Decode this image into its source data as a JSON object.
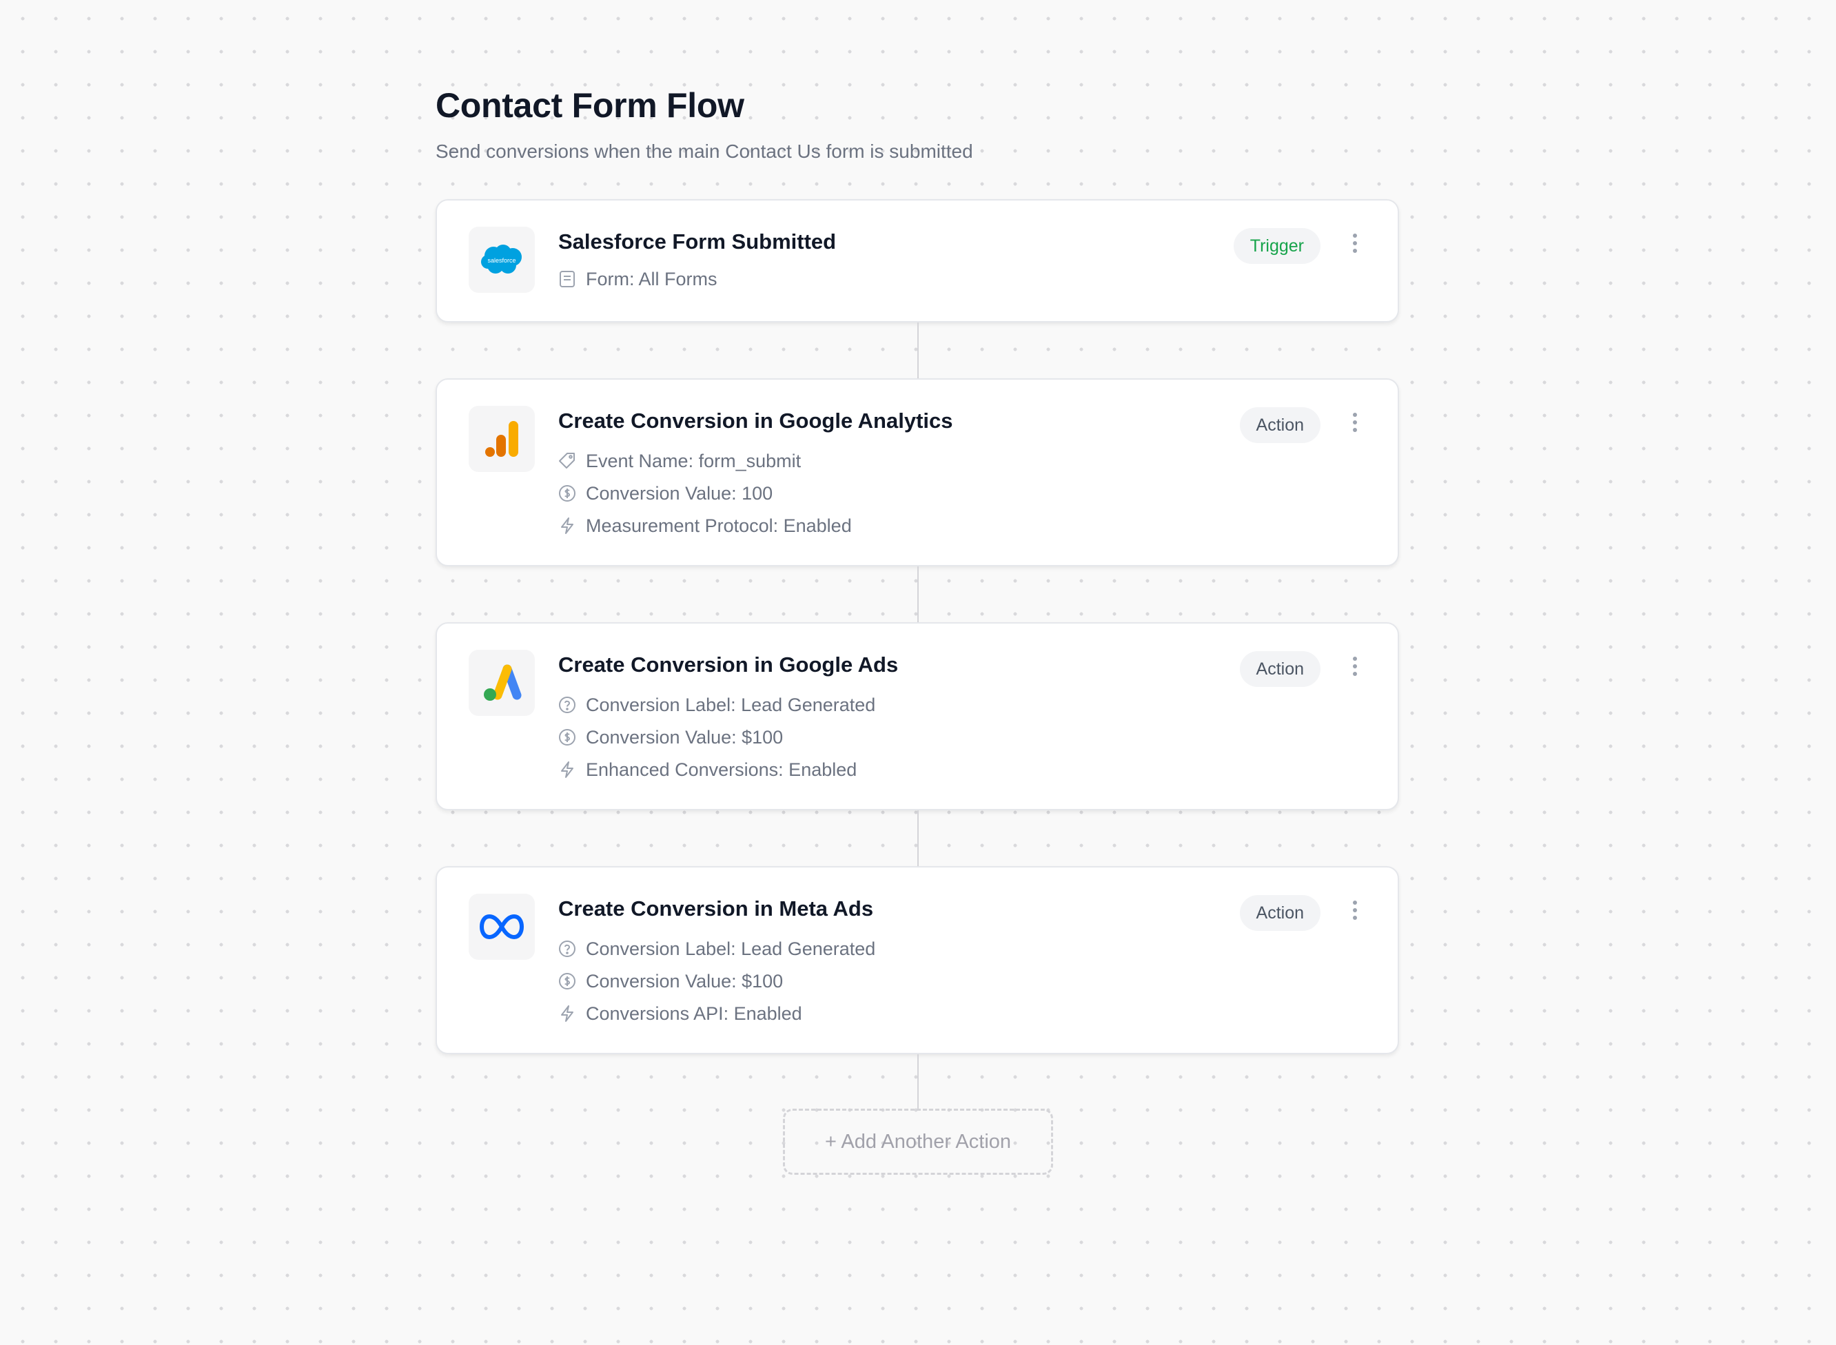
{
  "flow": {
    "title": "Contact Form Flow",
    "subtitle": "Send conversions when the main Contact Us form is submitted"
  },
  "steps": [
    {
      "title": "Salesforce Form Submitted",
      "badge": "Trigger",
      "logo": "salesforce-logo",
      "logo_text": "salesforce",
      "details": [
        {
          "icon": "form-icon",
          "text": "Form: All Forms"
        }
      ]
    },
    {
      "title": "Create Conversion in Google Analytics",
      "badge": "Action",
      "logo": "google-analytics-logo",
      "details": [
        {
          "icon": "tag-icon",
          "text": "Event Name: form_submit"
        },
        {
          "icon": "dollar-circle-icon",
          "text": "Conversion Value: 100"
        },
        {
          "icon": "lightning-icon",
          "text": "Measurement Protocol: Enabled"
        }
      ]
    },
    {
      "title": "Create Conversion in Google Ads",
      "badge": "Action",
      "logo": "google-ads-logo",
      "details": [
        {
          "icon": "help-circle-icon",
          "text": "Conversion Label: Lead Generated"
        },
        {
          "icon": "dollar-circle-icon",
          "text": "Conversion Value: $100"
        },
        {
          "icon": "lightning-icon",
          "text": "Enhanced Conversions: Enabled"
        }
      ]
    },
    {
      "title": "Create Conversion in Meta Ads",
      "badge": "Action",
      "logo": "meta-logo",
      "details": [
        {
          "icon": "help-circle-icon",
          "text": "Conversion Label: Lead Generated"
        },
        {
          "icon": "dollar-circle-icon",
          "text": "Conversion Value: $100"
        },
        {
          "icon": "lightning-icon",
          "text": "Conversions API: Enabled"
        }
      ]
    }
  ],
  "add_action_label": "+ Add Another Action",
  "colors": {
    "trigger_badge_text": "#16a34a",
    "action_badge_text": "#4b5563",
    "salesforce_blue": "#00a1e0",
    "ga_orange": "#f9ab00",
    "ga_dark_orange": "#e37400",
    "gads_blue": "#4285f4",
    "gads_yellow": "#fbbc04",
    "gads_green": "#34a853",
    "meta_blue": "#0866ff"
  }
}
